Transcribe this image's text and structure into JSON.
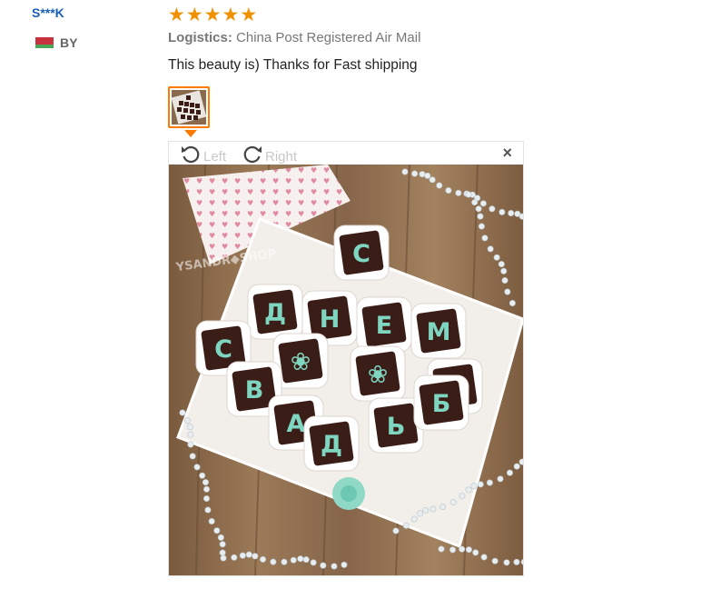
{
  "review": {
    "user_name": "S***K",
    "country_code": "BY",
    "rating": 5,
    "logistics_label": "Logistics:",
    "logistics_value": "China Post Registered Air Mail",
    "feedback_text": "This beauty is) Thanks for Fast shipping"
  },
  "viewer": {
    "rotate_left_label": "Left",
    "rotate_right_label": "Right",
    "close_symbol": "×"
  },
  "photo": {
    "row1": [
      "С"
    ],
    "row2": [
      "Д",
      "Н",
      "Е",
      "М"
    ],
    "row3": [
      "С",
      "❀",
      "❀",
      "Ы"
    ],
    "row4": [
      "В",
      "Ь",
      "Б"
    ],
    "row5": [
      "А",
      "Д"
    ],
    "watermark": "YSANDR◆SHOP"
  },
  "colors": {
    "star": "#f29100",
    "accent": "#ff7a00",
    "username": "#1a5fb4",
    "flag_red": "#c8313e",
    "flag_green": "#4aa657",
    "flag_white": "#ffffff",
    "mint": "#7fd6c0",
    "chocolate": "#3b1d18"
  },
  "icons": {
    "star": "star-icon",
    "rotate_left": "rotate-left-icon",
    "rotate_right": "rotate-right-icon",
    "close": "close-icon"
  }
}
